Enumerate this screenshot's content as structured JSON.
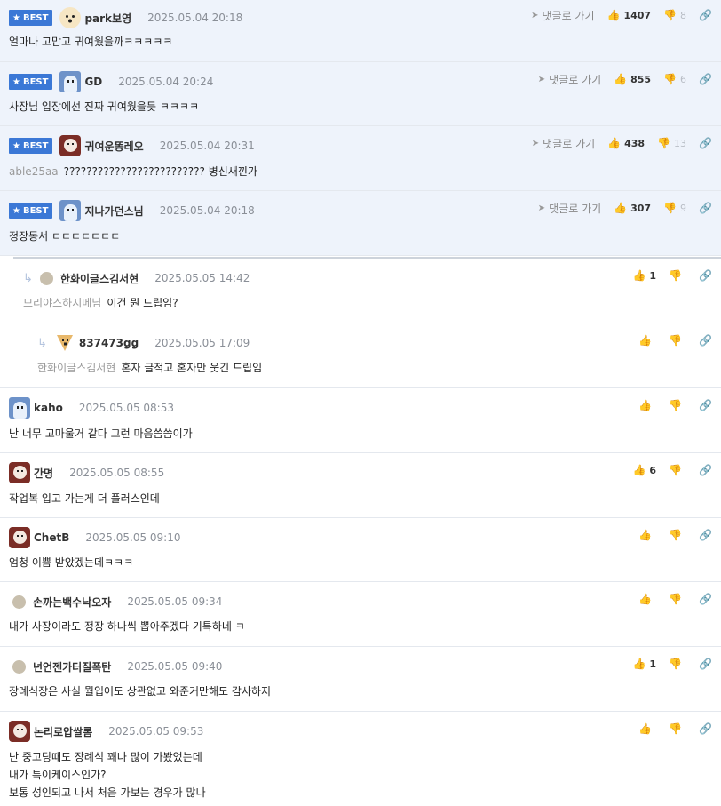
{
  "ui": {
    "best_label": "BEST",
    "goto_label": "댓글로 가기",
    "reply_arrow": "↳"
  },
  "comments": [
    {
      "kind": "best",
      "avatar": "dog-avatar",
      "nick": "park보영",
      "date": "2025.05.04 20:18",
      "tag": "",
      "text": "얼마나 고맙고 귀여웠을까ㅋㅋㅋㅋㅋ",
      "up": "1407",
      "down": "8"
    },
    {
      "kind": "best",
      "avatar": "ghost-avatar",
      "nick": "GD",
      "date": "2025.05.04 20:24",
      "tag": "",
      "text": "사장님 입장에선 진짜 귀여웠을듯 ㅋㅋㅋㅋ",
      "up": "855",
      "down": "6"
    },
    {
      "kind": "best",
      "avatar": "monkey-avatar",
      "nick": "귀여운똥레오",
      "date": "2025.05.04 20:31",
      "tag": "able25aa",
      "text": "????????????????????????? 병신새낀가",
      "up": "438",
      "down": "13"
    },
    {
      "kind": "best",
      "avatar": "ghost-avatar",
      "nick": "지나가던스님",
      "date": "2025.05.04 20:18",
      "tag": "",
      "text": "정장동서 ㄷㄷㄷㄷㄷㄷㄷ",
      "up": "307",
      "down": "9"
    },
    {
      "kind": "reply",
      "avatar": "dot-avatar",
      "nick": "한화이글스김서현",
      "date": "2025.05.05 14:42",
      "tag": "모리야스하지메님",
      "text": "이건 뭔 드립임?",
      "up": "1",
      "down": ""
    },
    {
      "kind": "reply2",
      "avatar": "fox-avatar",
      "nick": "837473gg",
      "date": "2025.05.05 17:09",
      "tag": "한화이글스김서현",
      "text": "혼자 글적고 혼자만 웃긴 드립임",
      "up": "",
      "down": ""
    },
    {
      "kind": "normal",
      "avatar": "ghost-avatar",
      "nick": "kaho",
      "date": "2025.05.05 08:53",
      "tag": "",
      "text": "난 너무 고마울거 같다 그런 마음씀씀이가",
      "up": "",
      "down": ""
    },
    {
      "kind": "normal",
      "avatar": "monkey-avatar",
      "nick": "간명",
      "date": "2025.05.05 08:55",
      "tag": "",
      "text": "작업복 입고 가는게 더 플러스인데",
      "up": "6",
      "down": ""
    },
    {
      "kind": "normal",
      "avatar": "monkey-avatar",
      "nick": "ChetB",
      "date": "2025.05.05 09:10",
      "tag": "",
      "text": "엄청 이쁨 받았겠는데ㅋㅋㅋ",
      "up": "",
      "down": ""
    },
    {
      "kind": "normal",
      "avatar": "dot-avatar",
      "nick": "손까는백수낙오자",
      "date": "2025.05.05 09:34",
      "tag": "",
      "text": "내가 사장이라도 정장 하나씩 뽑아주겠다 기특하네 ㅋ",
      "up": "",
      "down": ""
    },
    {
      "kind": "normal",
      "avatar": "dot-avatar",
      "nick": "넌언젠가터질폭탄",
      "date": "2025.05.05 09:40",
      "tag": "",
      "text": "장례식장은 사실 뭘입어도 상관없고 와준거만해도 감사하지",
      "up": "1",
      "down": ""
    },
    {
      "kind": "normal",
      "avatar": "monkey-avatar",
      "nick": "논리로압쌀롬",
      "date": "2025.05.05 09:53",
      "tag": "",
      "text": "난 중고딩때도 장례식 꽤나 많이 가봤었는데",
      "text2": "내가 특이케이스인가?",
      "text3": "보통 성인되고 나서 처음 가보는 경우가 많나",
      "up": "",
      "down": ""
    }
  ]
}
